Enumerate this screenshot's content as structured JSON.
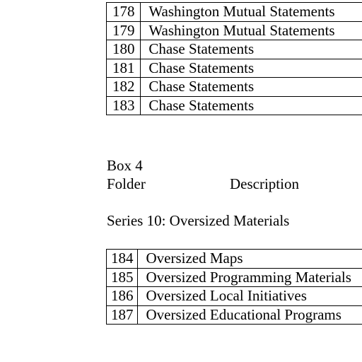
{
  "top_table": {
    "rows": [
      {
        "folder": "178",
        "description": "Washington Mutual Statements"
      },
      {
        "folder": "179",
        "description": "Washington Mutual Statements"
      },
      {
        "folder": "180",
        "description": "Chase Statements"
      },
      {
        "folder": "181",
        "description": "Chase Statements"
      },
      {
        "folder": "182",
        "description": "Chase Statements"
      },
      {
        "folder": "183",
        "description": "Chase Statements"
      }
    ]
  },
  "box": {
    "label": "Box 4",
    "folder_header": "Folder",
    "description_header": "Description"
  },
  "series": {
    "heading": "Series 10: Oversized Materials"
  },
  "bottom_table": {
    "rows": [
      {
        "folder": "184",
        "description": "Oversized Maps"
      },
      {
        "folder": "185",
        "description": "Oversized Programming Materials"
      },
      {
        "folder": "186",
        "description": "Oversized Local Initiatives"
      },
      {
        "folder": "187",
        "description": "Oversized Educational Programs"
      }
    ]
  }
}
